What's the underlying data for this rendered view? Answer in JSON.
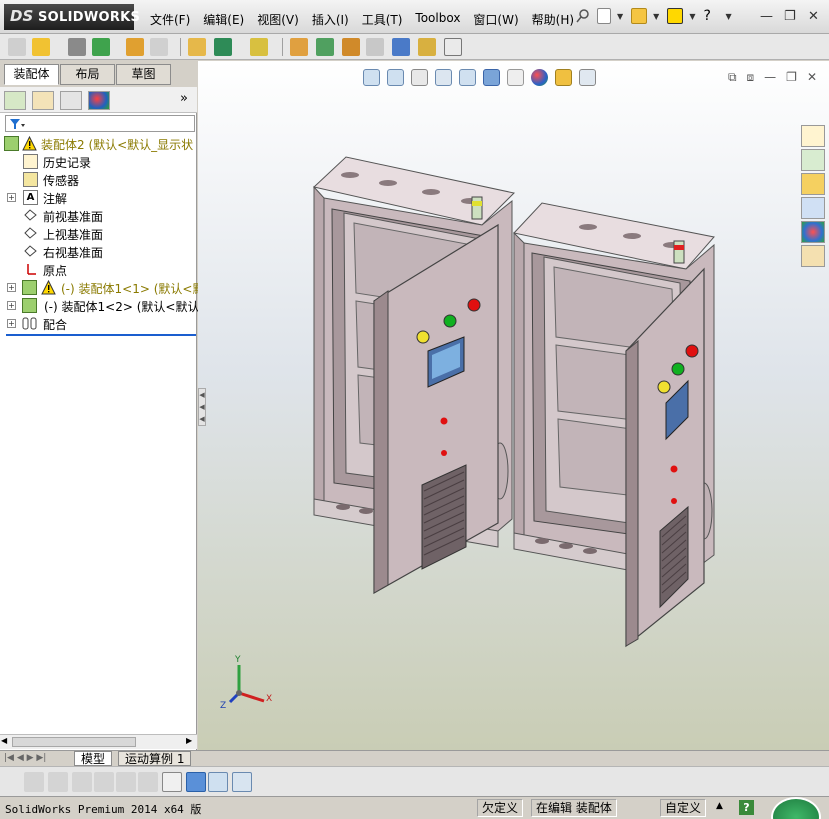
{
  "app": {
    "logo_ds": "DS",
    "logo_name": "SOLIDWORKS"
  },
  "menu": [
    "文件(F)",
    "编辑(E)",
    "视图(V)",
    "插入(I)",
    "工具(T)",
    "Toolbox",
    "窗口(W)",
    "帮助(H)"
  ],
  "window_controls": {
    "minimize": "—",
    "restore": "❐",
    "close": "✕"
  },
  "left_panel": {
    "tabs": [
      "装配体",
      "布局",
      "草图"
    ],
    "active_tab": "装配体",
    "filter_icon": "filter-icon",
    "collapse_symbol": "»",
    "tree": [
      {
        "label": "装配体2  (默认<默认_显示状",
        "icon": "assembly-icon",
        "warn": true,
        "expand": ""
      },
      {
        "label": "历史记录",
        "icon": "history-icon",
        "warn": false,
        "expand": ""
      },
      {
        "label": "传感器",
        "icon": "sensor-icon",
        "warn": false,
        "expand": ""
      },
      {
        "label": "注解",
        "icon": "annotation-icon",
        "warn": false,
        "expand": "+"
      },
      {
        "label": "前视基准面",
        "icon": "plane-icon",
        "warn": false,
        "expand": ""
      },
      {
        "label": "上视基准面",
        "icon": "plane-icon",
        "warn": false,
        "expand": ""
      },
      {
        "label": "右视基准面",
        "icon": "plane-icon",
        "warn": false,
        "expand": ""
      },
      {
        "label": "原点",
        "icon": "origin-icon",
        "warn": false,
        "expand": ""
      },
      {
        "label": "(-) 装配体1<1> (默认<默",
        "icon": "subassembly-icon",
        "warn": true,
        "expand": "+"
      },
      {
        "label": "(-) 装配体1<2> (默认<默认_",
        "icon": "subassembly-icon",
        "warn": false,
        "expand": "+"
      },
      {
        "label": "配合",
        "icon": "mates-icon",
        "warn": false,
        "expand": "+"
      }
    ]
  },
  "bottom_tabs": [
    "模型",
    "运动算例 1"
  ],
  "active_bottom_tab": "模型",
  "triad": {
    "x": "X",
    "y": "Y",
    "z": "Z"
  },
  "status": {
    "product": "SolidWorks Premium 2014 x64 版",
    "under_defined": "欠定义",
    "editing": "在编辑 装配体",
    "units": "自定义",
    "help": "?"
  },
  "colors": {
    "cabinet_body": "#c9b9bd",
    "cabinet_shadow": "#9c8a8e",
    "light_red": "#e01010",
    "light_green": "#10b020",
    "light_yellow": "#f0e030",
    "display_blue": "#4a6fa8"
  }
}
